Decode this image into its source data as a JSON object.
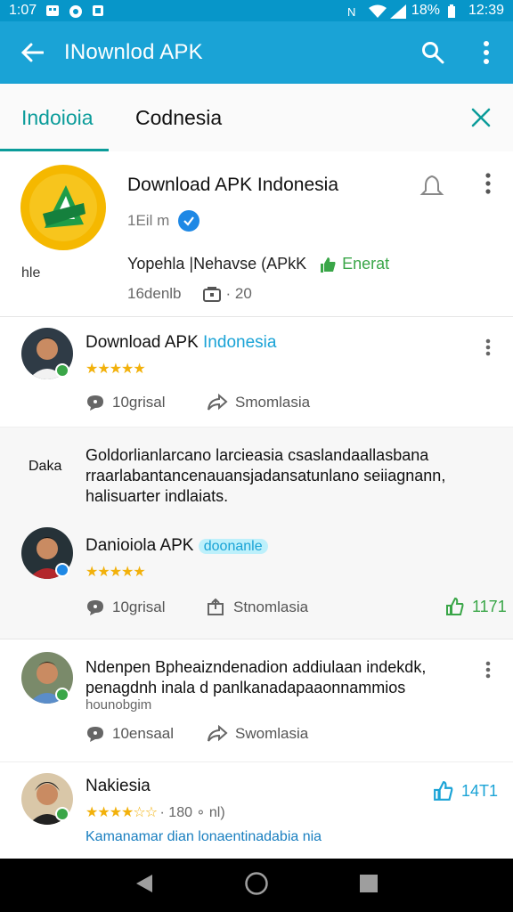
{
  "status_bar": {
    "time_left": "1:07",
    "battery": "18%",
    "clock": "12:39"
  },
  "app_bar": {
    "title": "INownlod APK"
  },
  "tabs": {
    "active": "Indoioia",
    "second": "Codnesia"
  },
  "app": {
    "name": "Download APK Indonesia",
    "size": "1Eil m",
    "logo_caption": "hle",
    "line": "Yopehla |Nehavse (APkK",
    "line_green": "Enerat",
    "sub_left": "16denlb",
    "sub_right": "· 20",
    "brand_color": "#f5b800",
    "accent": "#1aa3d6",
    "teal": "#0b9c9a"
  },
  "reviews": [
    {
      "name": "Download APK",
      "name_tag": "Indonesia",
      "stars": "★★★★★",
      "comment_label": "10grisal",
      "share_label": "Smomlasia"
    },
    {
      "side_label": "Daka",
      "body": [
        "Goldorlianlarcano larcieasia csaslandaallasbana",
        "rraarlabantancenauansjadansatunlano seiiagnann,",
        "halisuarter indlaiats."
      ]
    },
    {
      "name": "Danioiola APK",
      "name_tag": "doonanle",
      "stars": "★★★★★",
      "comment_label": "10grisal",
      "share_label": "Stnomlasia",
      "like_count": "1171"
    },
    {
      "body": [
        "Ndenpen Bpheaizndenadion addiulaan indekdk,",
        "penagdnh inala d panlkanadapaaonnammios",
        "hounobgim"
      ],
      "comment_label": "10ensaal",
      "share_label": "Swomlasia"
    },
    {
      "name": "Nakiesia",
      "stars": "★★★★☆☆",
      "meta": "· 180 ∘ nl)",
      "link": "Kamanamar dian lonaentinadabia nia",
      "like_count": "14T1"
    }
  ]
}
